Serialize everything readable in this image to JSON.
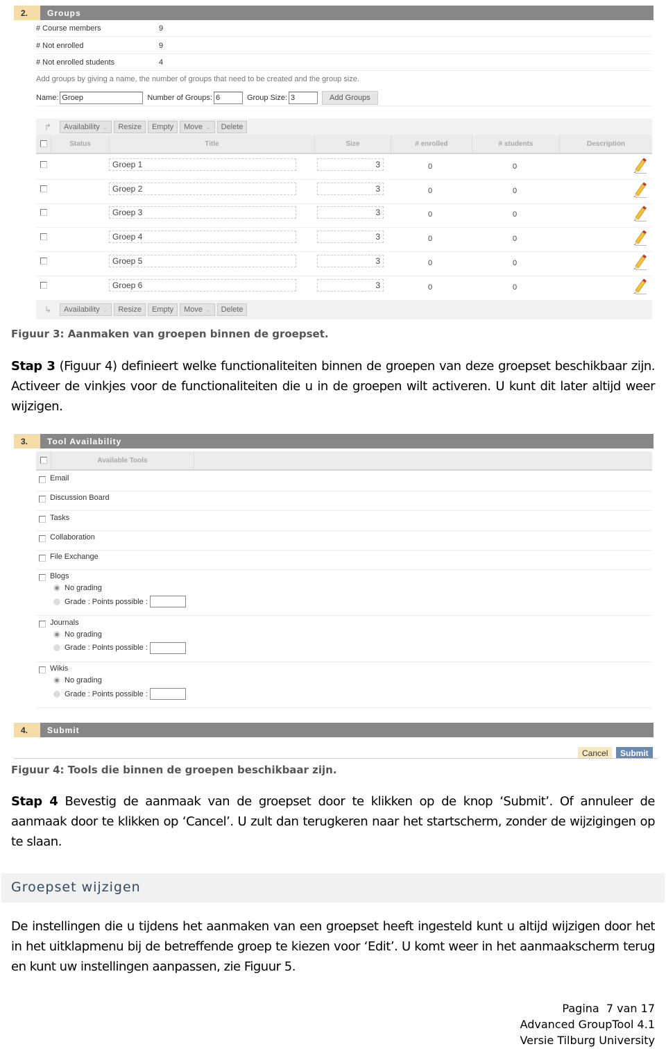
{
  "figure3": {
    "section": {
      "number": "2.",
      "title": "Groups"
    },
    "info": [
      {
        "label": "# Course members",
        "value": "9"
      },
      {
        "label": "# Not enrolled",
        "value": "9"
      },
      {
        "label": "# Not enrolled students",
        "value": "4"
      }
    ],
    "hint": "Add groups by giving a name, the number of groups that need to be created and the group size.",
    "form": {
      "name_label": "Name:",
      "name_value": "Groep",
      "count_label": "Number of Groups:",
      "count_value": "6",
      "size_label": "Group Size:",
      "size_value": "3",
      "add_button": "Add Groups"
    },
    "toolbar": {
      "availability": "Availability",
      "resize": "Resize",
      "empty": "Empty",
      "move": "Move",
      "delete": "Delete"
    },
    "columns": [
      "Status",
      "Title",
      "Size",
      "# enrolled",
      "# students",
      "Description"
    ],
    "rows": [
      {
        "title": "Groep 1",
        "size": "3",
        "enrolled": "0",
        "students": "0"
      },
      {
        "title": "Groep 2",
        "size": "3",
        "enrolled": "0",
        "students": "0"
      },
      {
        "title": "Groep 3",
        "size": "3",
        "enrolled": "0",
        "students": "0"
      },
      {
        "title": "Groep 4",
        "size": "3",
        "enrolled": "0",
        "students": "0"
      },
      {
        "title": "Groep 5",
        "size": "3",
        "enrolled": "0",
        "students": "0"
      },
      {
        "title": "Groep 6",
        "size": "3",
        "enrolled": "0",
        "students": "0"
      }
    ],
    "caption": "Figuur 3: Aanmaken van groepen binnen de groepset."
  },
  "para_stap3": {
    "bold": "Stap 3",
    "text": " (Figuur 4) definieert welke functionaliteiten binnen de groepen van deze groepset beschikbaar zijn. Activeer de vinkjes voor de functionaliteiten die u in de groepen wilt activeren. U kunt dit later altijd weer wijzigen."
  },
  "figure4": {
    "section": {
      "number": "3.",
      "title": "Tool Availability"
    },
    "column": "Available Tools",
    "tools": [
      "Email",
      "Discussion Board",
      "Tasks",
      "Collaboration",
      "File Exchange"
    ],
    "graded_tools": [
      {
        "name": "Blogs",
        "no_grading": "No grading",
        "grade": "Grade : Points possible :"
      },
      {
        "name": "Journals",
        "no_grading": "No grading",
        "grade": "Grade : Points possible :"
      },
      {
        "name": "Wikis",
        "no_grading": "No grading",
        "grade": "Grade : Points possible :"
      }
    ],
    "submit_section": {
      "number": "4.",
      "title": "Submit"
    },
    "cancel": "Cancel",
    "submit": "Submit",
    "caption": "Figuur 4: Tools die binnen de groepen beschikbaar zijn."
  },
  "para_stap4": {
    "bold": "Stap 4",
    "text": " Bevestig de aanmaak van de groepset door te klikken op de knop ‘Submit’. Of annuleer de aanmaak door te klikken op ‘Cancel’. U zult dan terugkeren naar het startscherm, zonder de wijzigingen op te slaan."
  },
  "heading": "Groepset wijzigen",
  "para_edit": "De instellingen die u tijdens het aanmaken van een groepset heeft ingesteld kunt u altijd wijzigen door het in het uitklapmenu bij de betreffende groep te kiezen voor ‘Edit’. U komt weer in het aanmaakscherm terug en kunt uw instellingen aanpassen, zie Figuur 5.",
  "footer": {
    "page": "Pagina  7 van 17",
    "product": "Advanced GroupTool 4.1",
    "version": "Versie Tilburg University"
  }
}
